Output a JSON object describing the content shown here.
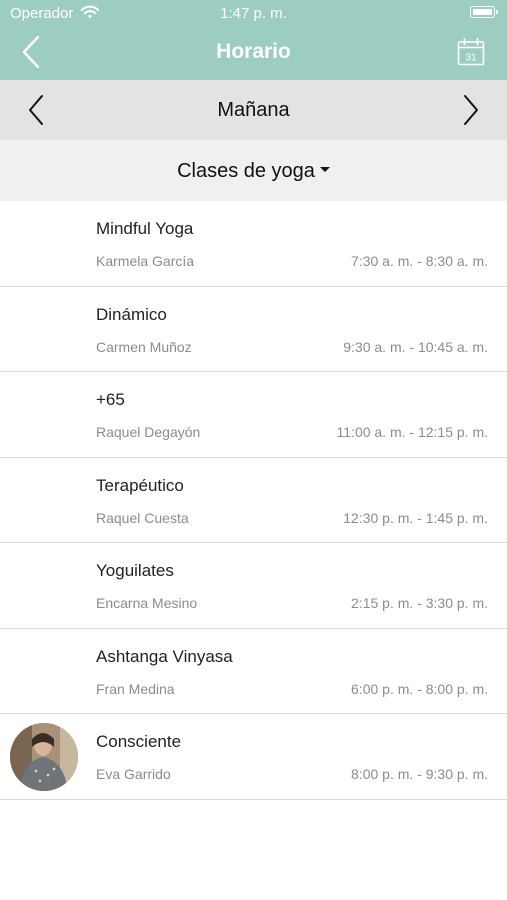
{
  "status_bar": {
    "carrier": "Operador",
    "time": "1:47 p. m."
  },
  "header": {
    "title": "Horario",
    "calendar_day": "31"
  },
  "day_nav": {
    "label": "Mañana"
  },
  "filter": {
    "label": "Clases de yoga"
  },
  "classes": [
    {
      "name": "Mindful Yoga",
      "teacher": "Karmela García",
      "time": "7:30 a. m. - 8:30 a. m."
    },
    {
      "name": "Dinámico",
      "teacher": "Carmen Muñoz",
      "time": "9:30 a. m. - 10:45 a. m."
    },
    {
      "name": "+65",
      "teacher": "Raquel Degayón",
      "time": "11:00 a. m. - 12:15 p. m."
    },
    {
      "name": "Terapéutico",
      "teacher": "Raquel Cuesta",
      "time": "12:30 p. m. - 1:45 p. m."
    },
    {
      "name": "Yoguilates",
      "teacher": "Encarna Mesino",
      "time": "2:15 p. m. - 3:30 p. m."
    },
    {
      "name": "Ashtanga Vinyasa",
      "teacher": "Fran Medina",
      "time": "6:00 p. m. - 8:00 p. m."
    },
    {
      "name": "Consciente",
      "teacher": "Eva Garrido",
      "time": "8:00 p. m. - 9:30 p. m."
    }
  ],
  "colors": {
    "header_bg": "#9dcdc0",
    "day_bar_bg": "#e3e3e3",
    "filter_bar_bg": "#f0f0f0",
    "secondary_text": "#8c8c8c"
  },
  "icons": {
    "back": "chevron-left-icon",
    "calendar": "calendar-icon",
    "prev_day": "chevron-left-icon",
    "next_day": "chevron-right-icon",
    "dropdown": "caret-down-icon"
  }
}
